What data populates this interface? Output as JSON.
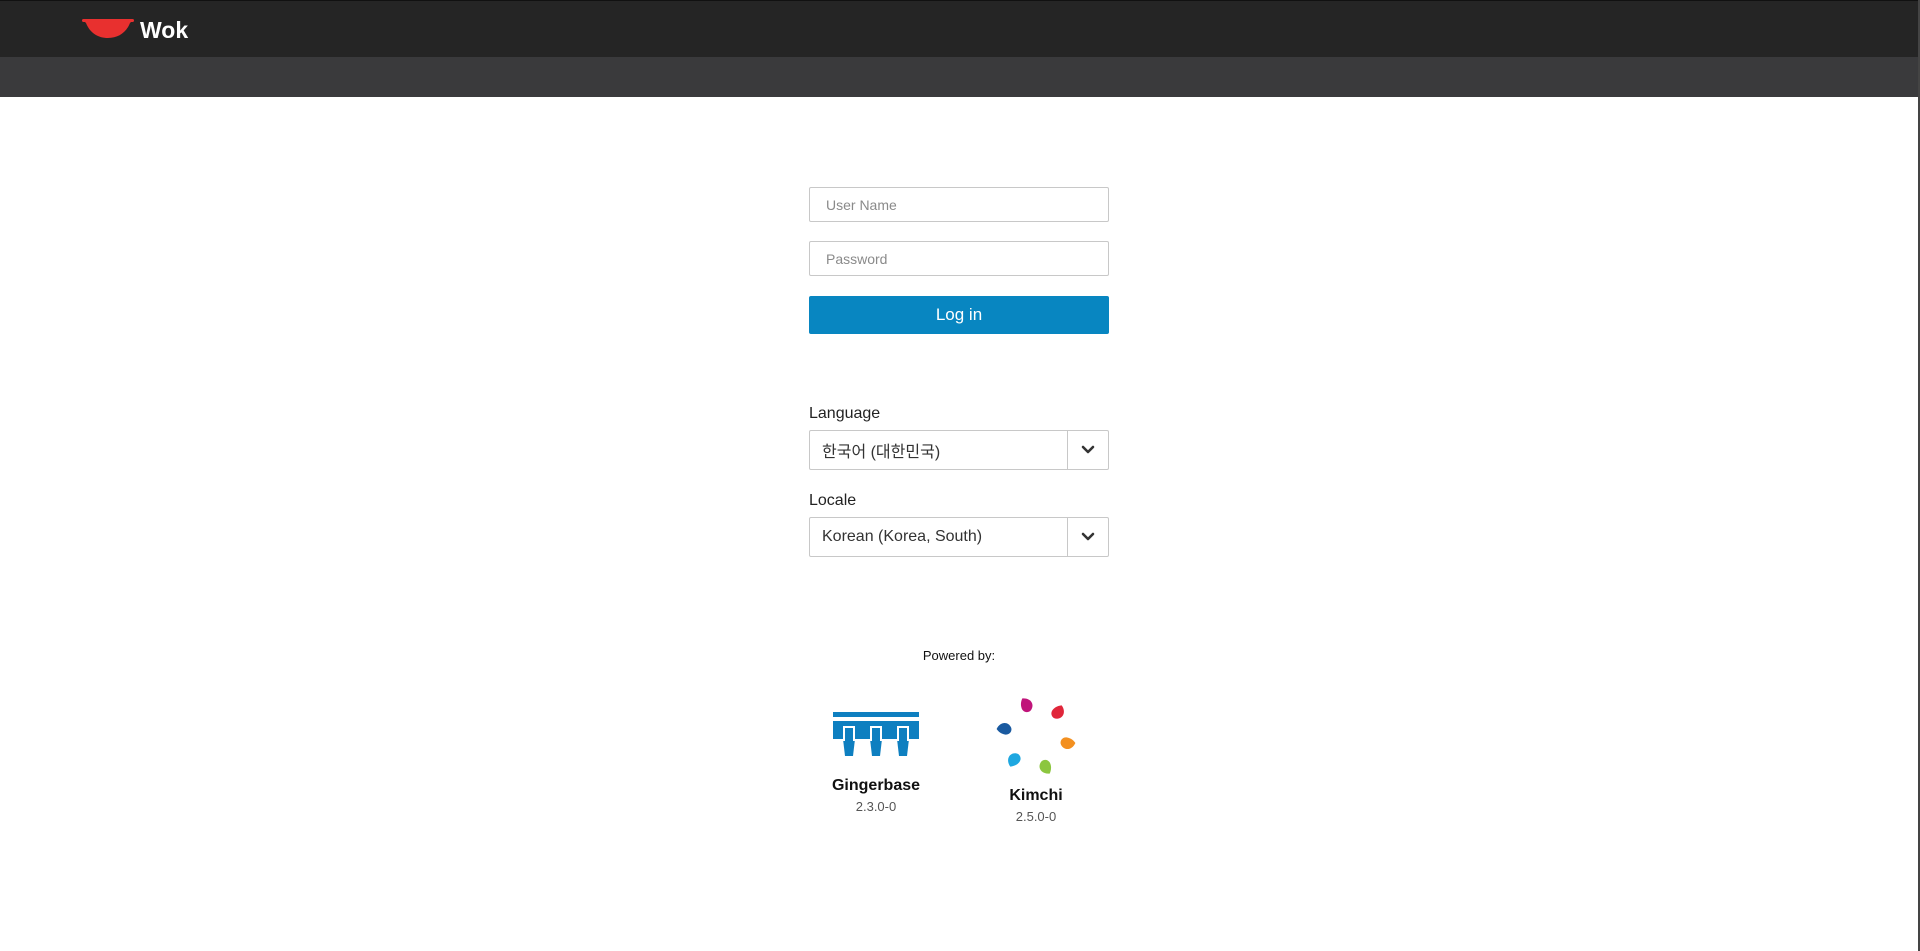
{
  "header": {
    "title": "Wok",
    "logo_icon": "wok-bowl-icon",
    "brand_color": "#e8302f"
  },
  "login": {
    "username_placeholder": "User Name",
    "password_placeholder": "Password",
    "login_label": "Log in",
    "button_color": "#0886c1"
  },
  "language": {
    "label": "Language",
    "selected": "한국어 (대한민국)"
  },
  "locale": {
    "label": "Locale",
    "selected": "Korean (Korea, South)"
  },
  "powered": {
    "label": "Powered by:",
    "plugins": [
      {
        "name": "Gingerbase",
        "version": "2.3.0-0",
        "icon": "gingerbase-logo-icon"
      },
      {
        "name": "Kimchi",
        "version": "2.5.0-0",
        "icon": "kimchi-logo-icon"
      }
    ]
  }
}
